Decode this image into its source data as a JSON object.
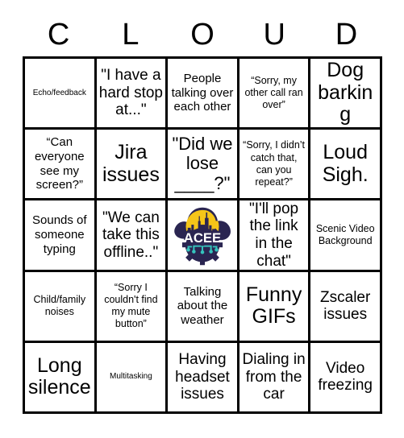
{
  "card": {
    "title_letters": [
      "C",
      "L",
      "O",
      "U",
      "D"
    ],
    "colors": {
      "grid_line": "#000000",
      "background": "#ffffff",
      "text": "#000000",
      "logo_navy": "#2a2551",
      "logo_yellow": "#f5c518",
      "logo_teal": "#35c4bd",
      "logo_white": "#ffffff"
    },
    "logo": {
      "name": "acee-logo",
      "wordmark": "ACEE",
      "description": "city skyline in a cloud with gear and circuit board"
    },
    "rows": [
      [
        {
          "text": "Echo/feedback",
          "size": "xs"
        },
        {
          "text": "\"I have a hard stop at...\"",
          "size": "lg"
        },
        {
          "text": "People talking over each other",
          "size": "md"
        },
        {
          "text": "“Sorry, my other call ran over”",
          "size": "sm"
        },
        {
          "text": "Dog barking",
          "size": "xxl"
        }
      ],
      [
        {
          "text": "“Can everyone see my screen?”",
          "size": "md"
        },
        {
          "text": "Jira issues",
          "size": "xxl"
        },
        {
          "text": "\"Did we lose ____?\"",
          "size": "xl"
        },
        {
          "text": "“Sorry, I didn’t catch that, can you repeat?”",
          "size": "sm"
        },
        {
          "text": "Loud Sigh.",
          "size": "xxl"
        }
      ],
      [
        {
          "text": "Sounds of someone typing",
          "size": "md"
        },
        {
          "text": "\"We can take this offline..\"",
          "size": "lg"
        },
        {
          "text": "",
          "size": "md",
          "logo": true
        },
        {
          "text": "\"I'll pop the link in the chat\"",
          "size": "lg"
        },
        {
          "text": "Scenic Video Background",
          "size": "sm"
        }
      ],
      [
        {
          "text": "Child/family noises",
          "size": "sm"
        },
        {
          "text": "“Sorry I couldn't find my mute button”",
          "size": "sm"
        },
        {
          "text": "Talking about the weather",
          "size": "md"
        },
        {
          "text": "Funny GIFs",
          "size": "xxl"
        },
        {
          "text": "Zscaler issues",
          "size": "lg"
        }
      ],
      [
        {
          "text": "Long silence",
          "size": "xxl"
        },
        {
          "text": "Multitasking",
          "size": "xs"
        },
        {
          "text": "Having headset issues",
          "size": "lg"
        },
        {
          "text": "Dialing in from the car",
          "size": "lg"
        },
        {
          "text": "Video freezing",
          "size": "lg"
        }
      ]
    ]
  }
}
